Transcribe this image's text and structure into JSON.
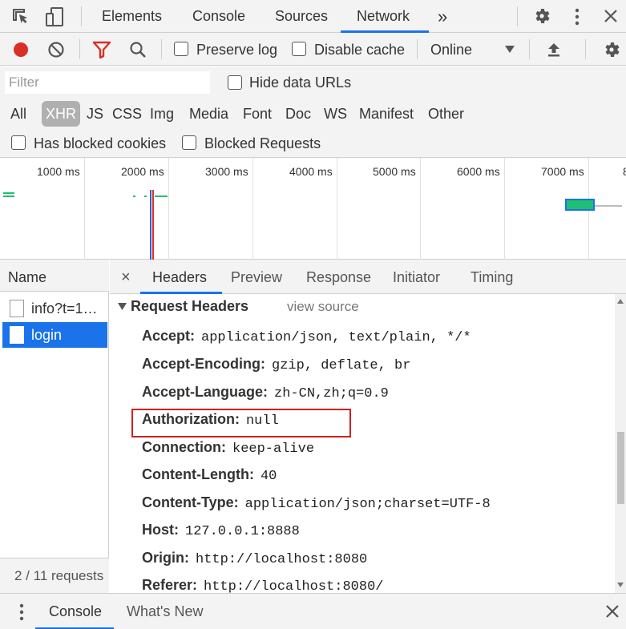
{
  "top_tabs": {
    "elements": "Elements",
    "console": "Console",
    "sources": "Sources",
    "network": "Network",
    "more": "»"
  },
  "toolbar": {
    "preserve_log": "Preserve log",
    "disable_cache": "Disable cache",
    "throttle": "Online",
    "record_color": "#d93025",
    "filter_color": "#d93025"
  },
  "filter": {
    "placeholder": "Filter",
    "hide_data_urls": "Hide data URLs"
  },
  "types": [
    "All",
    "XHR",
    "JS",
    "CSS",
    "Img",
    "Media",
    "Font",
    "Doc",
    "WS",
    "Manifest",
    "Other"
  ],
  "blocked": {
    "has_blocked_cookies": "Has blocked cookies",
    "blocked_requests": "Blocked Requests"
  },
  "timeline": {
    "ticks": [
      "1000 ms",
      "2000 ms",
      "3000 ms",
      "4000 ms",
      "5000 ms",
      "6000 ms",
      "7000 ms",
      "8"
    ]
  },
  "requests": {
    "header": "Name",
    "items": [
      "info?t=1…",
      "login"
    ],
    "footer": "2 / 11 requests"
  },
  "detail_tabs": {
    "close": "×",
    "headers": "Headers",
    "preview": "Preview",
    "response": "Response",
    "initiator": "Initiator",
    "timing": "Timing"
  },
  "request_headers": {
    "title": "Request Headers",
    "view_source": "view source",
    "rows": [
      {
        "name": "Accept:",
        "value": "application/json, text/plain, */*"
      },
      {
        "name": "Accept-Encoding:",
        "value": "gzip, deflate, br"
      },
      {
        "name": "Accept-Language:",
        "value": "zh-CN,zh;q=0.9"
      },
      {
        "name": "Authorization:",
        "value": "null"
      },
      {
        "name": "Connection:",
        "value": "keep-alive"
      },
      {
        "name": "Content-Length:",
        "value": "40"
      },
      {
        "name": "Content-Type:",
        "value": "application/json;charset=UTF-8"
      },
      {
        "name": "Host:",
        "value": "127.0.0.1:8888"
      },
      {
        "name": "Origin:",
        "value": "http://localhost:8080"
      },
      {
        "name": "Referer:",
        "value": "http://localhost:8080/"
      }
    ]
  },
  "drawer": {
    "console": "Console",
    "whats_new": "What's New"
  }
}
